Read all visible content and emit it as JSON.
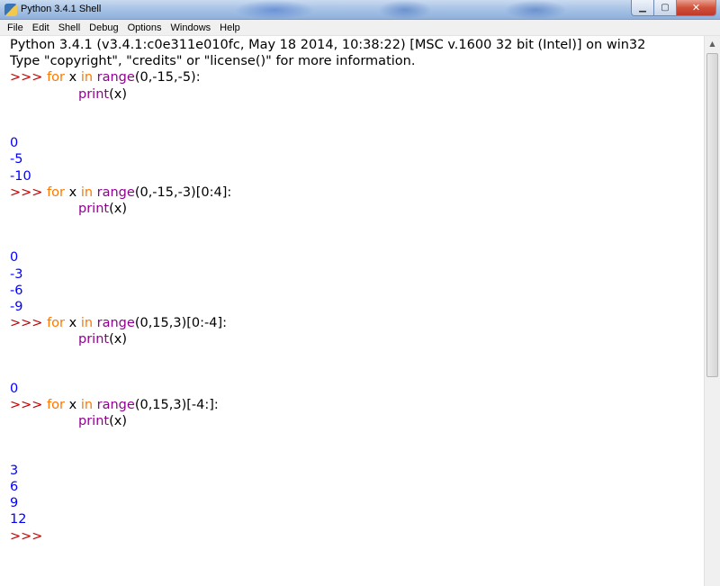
{
  "window": {
    "title": "Python 3.4.1 Shell",
    "controls": {
      "minimize": "▁",
      "maximize": "▢",
      "close": "✕"
    }
  },
  "menu": [
    "File",
    "Edit",
    "Shell",
    "Debug",
    "Options",
    "Windows",
    "Help"
  ],
  "shell": {
    "banner": [
      "Python 3.4.1 (v3.4.1:c0e311e010fc, May 18 2014, 10:38:22) [MSC v.1600 32 bit (Intel)] on win32",
      "Type \"copyright\", \"credits\" or \"license()\" for more information."
    ],
    "prompt": ">>> ",
    "blocks": [
      {
        "for_kw": "for",
        "var": " x ",
        "in_kw": "in",
        "fn": "range",
        "args": "(0,-15,-5):",
        "body_fn": "print",
        "body_args": "(x)",
        "output": [
          "0",
          "-5",
          "-10"
        ]
      },
      {
        "for_kw": "for",
        "var": " x ",
        "in_kw": "in",
        "fn": "range",
        "args": "(0,-15,-3)[0:4]:",
        "body_fn": "print",
        "body_args": "(x)",
        "output": [
          "0",
          "-3",
          "-6",
          "-9"
        ]
      },
      {
        "for_kw": "for",
        "var": " x ",
        "in_kw": "in",
        "fn": "range",
        "args": "(0,15,3)[0:-4]:",
        "body_fn": "print",
        "body_args": "(x)",
        "output": [
          "0"
        ]
      },
      {
        "for_kw": "for",
        "var": " x ",
        "in_kw": "in",
        "fn": "range",
        "args": "(0,15,3)[-4:]:",
        "body_fn": "print",
        "body_args": "(x)",
        "output": [
          "3",
          "6",
          "9",
          "12"
        ]
      }
    ],
    "final_prompt": ">>>"
  },
  "colors": {
    "prompt": "#c00000",
    "keyword": "#ff7700",
    "builtin": "#900090",
    "output": "#0000ff"
  },
  "scrollbar": {
    "up_arrow": "▲"
  }
}
